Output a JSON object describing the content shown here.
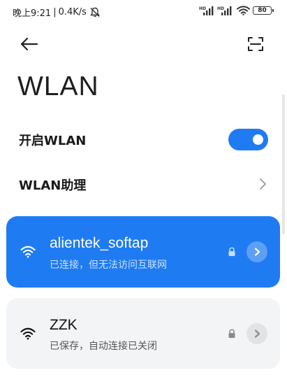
{
  "status_bar": {
    "time": "晚上9:21",
    "separator": "|",
    "net_speed": "0.4K/s",
    "battery": "80",
    "icons": [
      "mute-bell-icon",
      "hd-signal-icon",
      "hd-signal-icon",
      "wifi-icon",
      "battery-icon"
    ]
  },
  "header": {
    "back_icon": "arrow-left-icon",
    "scan_icon": "scan-icon",
    "title": "WLAN"
  },
  "settings": {
    "enable_wlan_label": "开启WLAN",
    "enable_wlan_on": true,
    "assistant_label": "WLAN助理"
  },
  "networks": [
    {
      "name": "alientek_softap",
      "status": "已连接，但无法访问互联网",
      "secured": true,
      "connected": true
    },
    {
      "name": "ZZK",
      "status": "已保存，自动连接已关闭",
      "secured": true,
      "connected": false
    }
  ],
  "colors": {
    "accent": "#1f7bf2",
    "card_inactive": "#f3f4f6",
    "text_primary": "#1a1a1a"
  }
}
